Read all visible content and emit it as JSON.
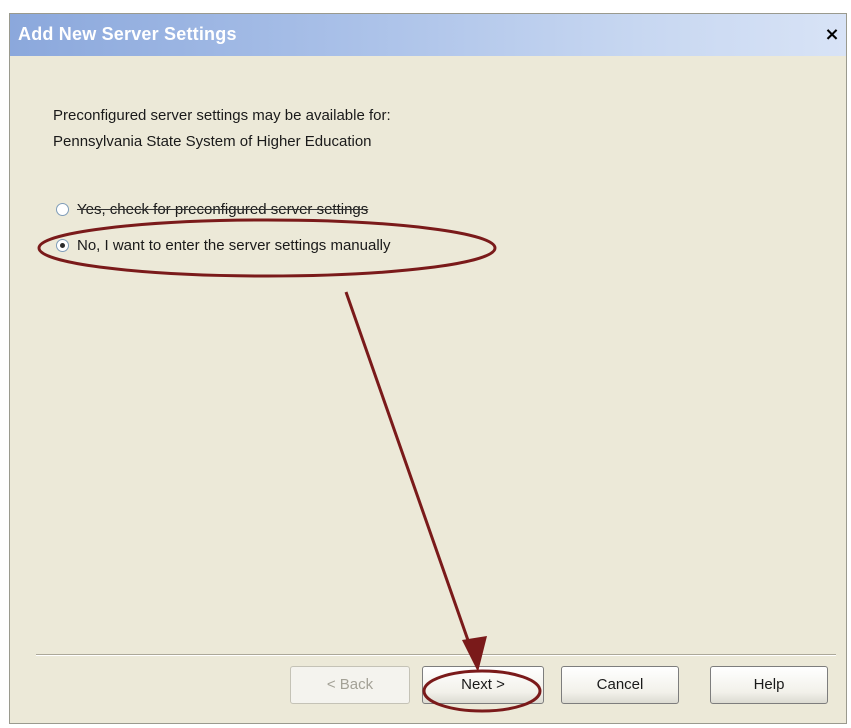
{
  "window": {
    "title": "Add New Server Settings",
    "close_label": "×"
  },
  "info": {
    "line1": "Preconfigured server settings may be available for:",
    "line2": "Pennsylvania State System of Higher Education"
  },
  "options": [
    {
      "label": "Yes, check for preconfigured server settings",
      "checked": false
    },
    {
      "label": "No, I want to enter the server settings manually",
      "checked": true
    }
  ],
  "buttons": {
    "back": "< Back",
    "next": "Next >",
    "cancel": "Cancel",
    "help": "Help"
  },
  "colors": {
    "annotation": "#7a1a1a",
    "titlebar": "#8ba8dc",
    "dialog_bg": "#ece9d8"
  }
}
